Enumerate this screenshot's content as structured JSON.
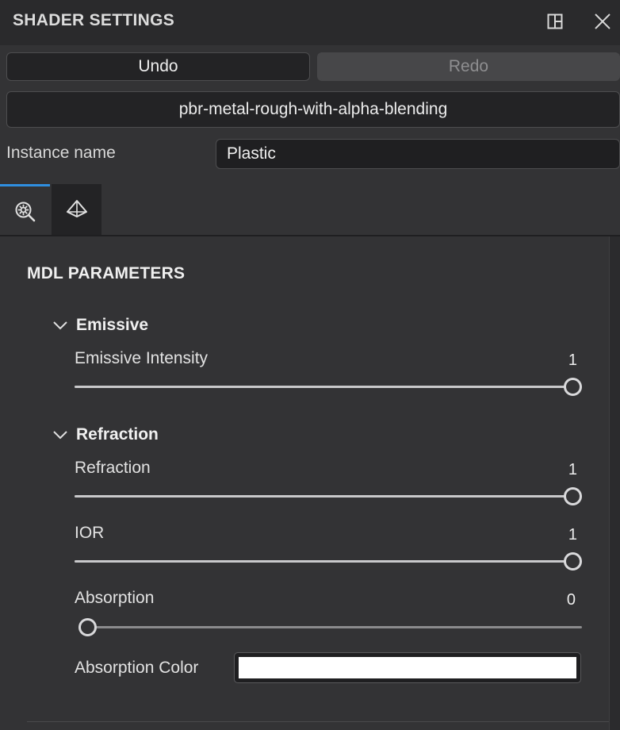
{
  "panel": {
    "title": "SHADER SETTINGS",
    "icons": {
      "dock": "dock-layout-icon",
      "close": "close-icon"
    }
  },
  "toolbar": {
    "undo_label": "Undo",
    "redo_label": "Redo"
  },
  "shader": {
    "name": "pbr-metal-rough-with-alpha-blending"
  },
  "instance": {
    "label": "Instance name",
    "value": "Plastic"
  },
  "tabs": [
    {
      "icon": "search-gear-icon",
      "active": true
    },
    {
      "icon": "material-icon",
      "active": false
    }
  ],
  "section": {
    "title": "MDL PARAMETERS"
  },
  "groups": [
    {
      "name": "Emissive",
      "expanded": true,
      "params": [
        {
          "label": "Emissive Intensity",
          "value": "1",
          "fraction": 1.0
        }
      ]
    },
    {
      "name": "Refraction",
      "expanded": true,
      "params": [
        {
          "label": "Refraction",
          "value": "1",
          "fraction": 1.0
        },
        {
          "label": "IOR",
          "value": "1",
          "fraction": 1.0
        },
        {
          "label": "Absorption",
          "value": "0",
          "fraction": 0.0
        }
      ],
      "color_param": {
        "label": "Absorption Color",
        "color": "#ffffff"
      }
    }
  ],
  "colors": {
    "accent": "#2f8fe0",
    "background": "#333335",
    "header": "#2a2a2c"
  }
}
